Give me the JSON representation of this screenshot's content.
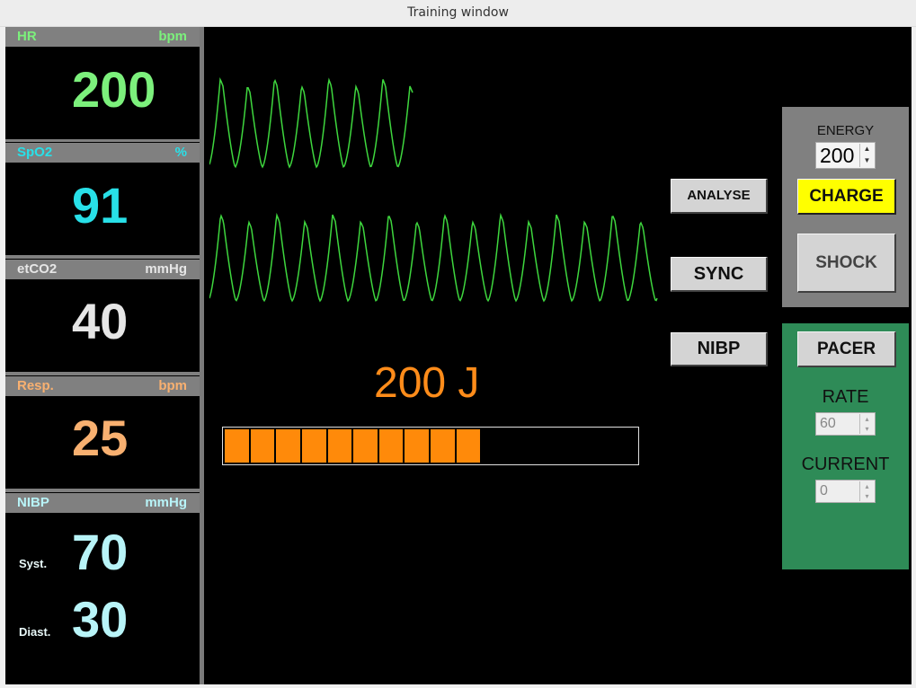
{
  "window": {
    "title": "Training window"
  },
  "vitals": {
    "hr": {
      "label": "HR",
      "unit": "bpm",
      "value": "200",
      "color": "#7cf07c"
    },
    "spo2": {
      "label": "SpO2",
      "unit": "%",
      "value": "91",
      "color": "#28e0e8"
    },
    "etco2": {
      "label": "etCO2",
      "unit": "mmHg",
      "value": "40",
      "color": "#e6e6e6"
    },
    "resp": {
      "label": "Resp.",
      "unit": "bpm",
      "value": "25",
      "color": "#f8b070"
    },
    "nibp": {
      "label": "NIBP",
      "unit": "mmHg",
      "color": "#b8f4f8",
      "syst_label": "Syst.",
      "syst_value": "70",
      "diast_label": "Diast.",
      "diast_value": "30"
    }
  },
  "waveforms": {
    "color": "#3ed63e",
    "pleth_top": {
      "cycles": 7.5
    },
    "pleth_bottom": {
      "cycles": 16
    }
  },
  "buttons": {
    "analyse": "ANALYSE",
    "sync": "SYNC",
    "nibp": "NIBP"
  },
  "charge": {
    "energy_display": "200 J",
    "segments_filled": 10,
    "segments_total": 16,
    "color": "#ff8a0a"
  },
  "defib_panel": {
    "energy_label": "ENERGY",
    "energy_value": "200",
    "charge_label": "CHARGE",
    "charge_color": "#ffff00",
    "shock_label": "SHOCK"
  },
  "pacer_panel": {
    "pacer_label": "PACER",
    "rate_label": "RATE",
    "rate_value": "60",
    "current_label": "CURRENT",
    "current_value": "0",
    "panel_color": "#2e8b57"
  }
}
